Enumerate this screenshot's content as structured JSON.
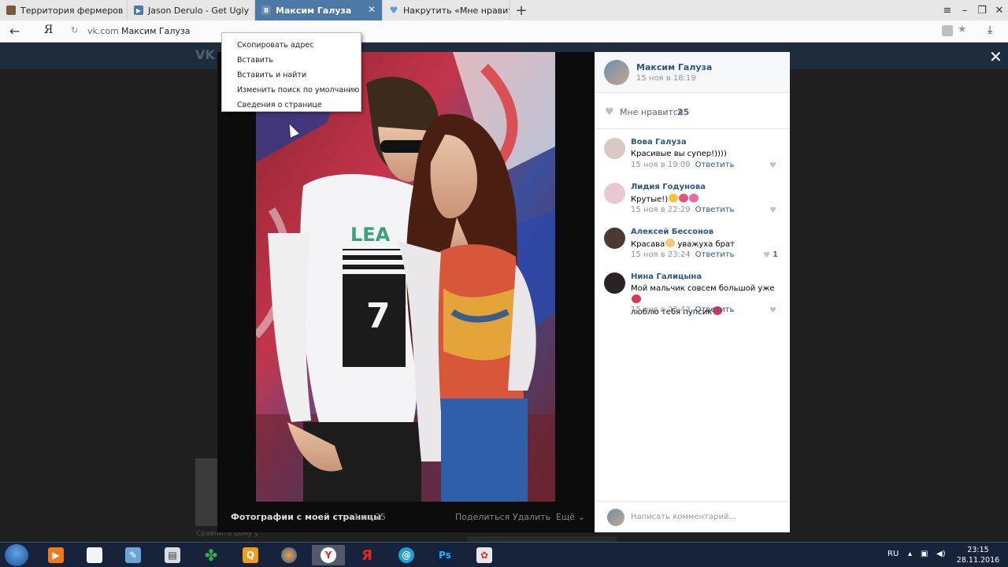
{
  "browser": {
    "tabs": [
      {
        "title": "Территория фермеров",
        "active": false,
        "fav_color": "#7a5a3a"
      },
      {
        "title": "Jason Derulo - Get Ugly",
        "active": false,
        "fav_color": "#4d79a8"
      },
      {
        "title": "Максим Галуза",
        "active": true,
        "fav_color": "#ffffff"
      },
      {
        "title": "Накрутить «Мне нравится»",
        "active": false,
        "fav_color": "#5a9bd5"
      }
    ],
    "new_tab": "+",
    "address": {
      "domain": "vk.com",
      "page_title": "Максим Галуза"
    }
  },
  "context_menu": {
    "items": [
      "Скопировать адрес",
      "Вставить",
      "Вставить и найти",
      "Изменить поиск по умолчанию",
      "Сведения о странице"
    ]
  },
  "viewer": {
    "album": "Фотографии с моей страницы",
    "counter": "1 из 35",
    "actions": {
      "share": "Поделиться",
      "delete": "Удалить",
      "more": "Ещё"
    }
  },
  "post": {
    "author": "Максим Галуза",
    "date": "15 ноя в 18:19",
    "likes_label": "Мне нравится",
    "likes_count": "25"
  },
  "comments": [
    {
      "name": "Вова Галуза",
      "text": "Красивые вы супер!))))",
      "time": "15 ноя в 19:09",
      "reply": "Ответить",
      "likes": "",
      "avatar_color": "#d9c7c2"
    },
    {
      "name": "Лидия Годунова",
      "text": "Крутые!)",
      "emoji": [
        "#f5c33b",
        "#e2557a",
        "#e86aa6"
      ],
      "time": "15 ноя в 22:29",
      "reply": "Ответить",
      "likes": "",
      "avatar_color": "#e8c9cf"
    },
    {
      "name": "Алексей Бессонов",
      "text": "Красава",
      "text_after_emoji": " уважуха брат",
      "emoji": [
        "#f0c878"
      ],
      "time": "15 ноя в 23:24",
      "reply": "Ответить",
      "likes": "1",
      "avatar_color": "#4a3a32"
    },
    {
      "name": "Нина Галицына",
      "text": "Мой мальчик совсем большой уже",
      "text_line2": "люблю тебя пупсик",
      "emoji": [
        "#d8365a"
      ],
      "time": "15 ноя в 23:43",
      "reply": "Ответить",
      "likes": "",
      "avatar_color": "#2a2226"
    }
  ],
  "comment_input": {
    "placeholder": "Написать комментарий..."
  },
  "background_page": {
    "hint": "Сравните цену у"
  },
  "taskbar": {
    "language": "RU",
    "time": "23:15",
    "date": "28.11.2016"
  }
}
